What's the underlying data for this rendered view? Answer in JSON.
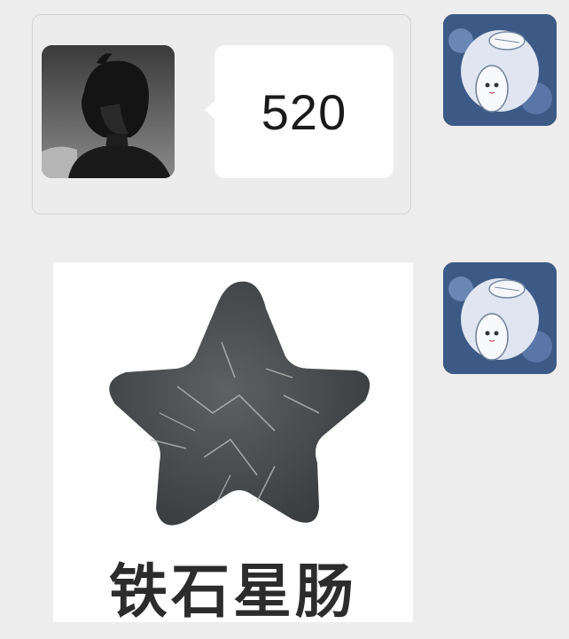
{
  "quoted_message": {
    "text": "520",
    "sender_avatar": "dark-haired-boy-avatar"
  },
  "self_avatar": "anime-girl-blue-avatar",
  "sticker": {
    "icon": "gray-stone-star",
    "caption": "铁石星肠"
  },
  "colors": {
    "chat_background": "#ededed",
    "bubble": "#ffffff",
    "avatar_blue": "#3d5a86"
  }
}
